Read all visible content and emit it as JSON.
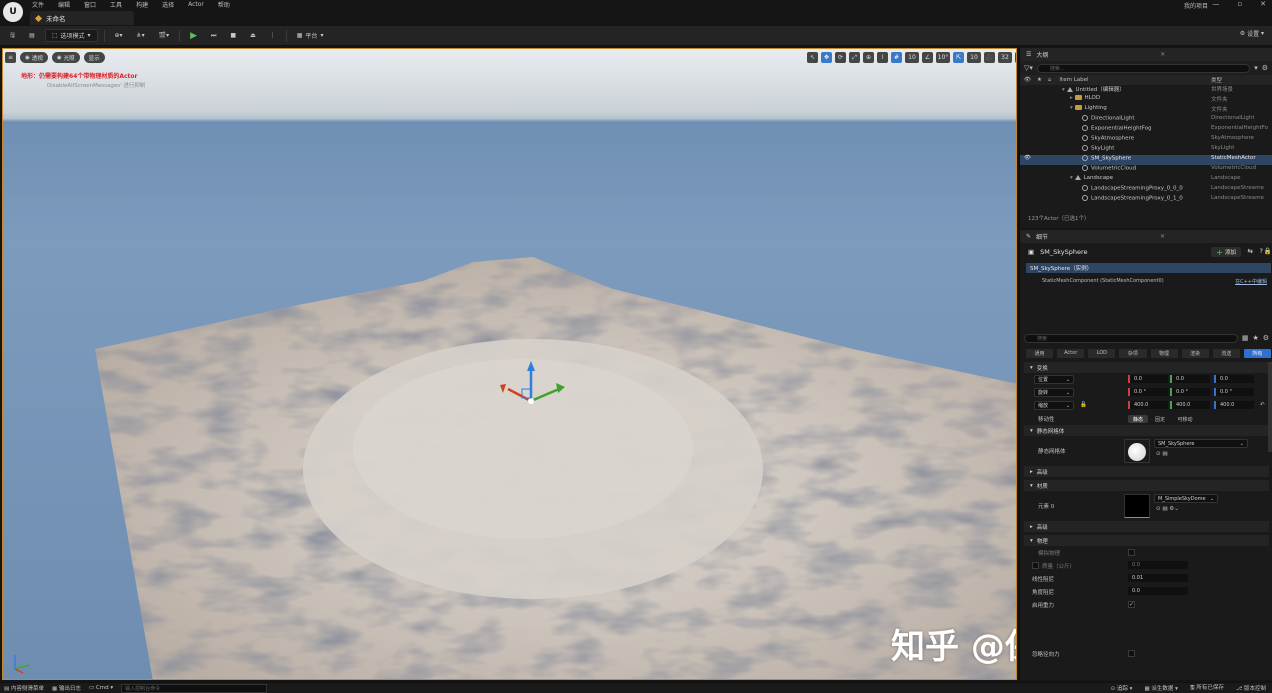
{
  "menubar": {
    "logo": "U",
    "items": [
      "文件",
      "编辑",
      "窗口",
      "工具",
      "构建",
      "选择",
      "Actor",
      "帮助"
    ],
    "tab_title": "未命名",
    "project_name": "我的项目",
    "window_controls": [
      "—",
      "▫",
      "✕"
    ]
  },
  "toolbar": {
    "mode_label": "选项模式",
    "platform_label": "平台",
    "settings_label": "设置"
  },
  "viewport": {
    "pills": [
      "透视",
      "光照",
      "显示"
    ],
    "right_numbers": [
      "10",
      "10°",
      "10",
      "32"
    ],
    "message_red": "地形：仍需要构建64个带物理材质的Actor",
    "message_gray": "DisableAllScreenMessages' 进行抑制",
    "watermark": "知乎 @保护我小月月"
  },
  "outliner": {
    "tab_title": "大纲",
    "search_placeholder": "搜索...",
    "col_label": "Item Label",
    "col_type": "类型",
    "rows": [
      {
        "label": "Untitled（编辑器）",
        "type": "世界场景",
        "indent": 0
      },
      {
        "label": "HLOD",
        "type": "文件夹",
        "indent": 1
      },
      {
        "label": "Lighting",
        "type": "文件夹",
        "indent": 1
      },
      {
        "label": "DirectionalLight",
        "type": "DirectionalLight",
        "indent": 2
      },
      {
        "label": "ExponentialHeightFog",
        "type": "ExponentialHeightFo",
        "indent": 2
      },
      {
        "label": "SkyAtmosphere",
        "type": "SkyAtmosphere",
        "indent": 2
      },
      {
        "label": "SkyLight",
        "type": "SkyLight",
        "indent": 2
      },
      {
        "label": "SM_SkySphere",
        "type": "StaticMeshActor",
        "indent": 2
      },
      {
        "label": "VolumetricCloud",
        "type": "VolumetricCloud",
        "indent": 2
      },
      {
        "label": "Landscape",
        "type": "Landscape",
        "indent": 1
      },
      {
        "label": "LandscapeStreamingProxy_0_0_0",
        "type": "LandscapeStreame",
        "indent": 2
      },
      {
        "label": "LandscapeStreamingProxy_0_1_0",
        "type": "LandscapeStreame",
        "indent": 2
      }
    ],
    "count_text": "123个Actor（已选1个）"
  },
  "details": {
    "tab_title": "细节",
    "actor_name": "SM_SkySphere",
    "add_label": "添加",
    "component_root": "SM_SkySphere（实例）",
    "component_child": "StaticMeshComponent (StaticMeshComponent0)",
    "component_cpp": "在C++中编辑",
    "search_placeholder": "搜索",
    "category_tabs": [
      "通用",
      "Actor",
      "LOD",
      "杂项",
      "物理",
      "渲染",
      "流送",
      "所有"
    ],
    "transform_section": "变换",
    "location_label": "位置",
    "rotation_label": "旋转",
    "scale_label": "缩放",
    "location": [
      "0.0",
      "0.0",
      "0.0"
    ],
    "rotation": [
      "0.0 °",
      "0.0 °",
      "0.0 °"
    ],
    "scale": [
      "400.0",
      "400.0",
      "400.0"
    ],
    "mobility_label": "移动性",
    "mobility_options": [
      "静态",
      "固定",
      "可移动"
    ],
    "static_mesh_section": "静态网格体",
    "static_mesh_label": "静态网格体",
    "static_mesh_value": "SM_SkySphere",
    "advanced_section": "高级",
    "materials_section": "材质",
    "element_label": "元素 0",
    "material_value": "M_SimpleSkyDome",
    "advanced_section2": "高级",
    "physics_section": "物理",
    "simulate_physics": "模拟物理",
    "mass_label": "质量（公斤）",
    "mass_value": "0.0",
    "linear_damping": "线性阻尼",
    "linear_damping_value": "0.01",
    "angular_damping": "角度阻尼",
    "angular_damping_value": "0.0",
    "enable_gravity": "启用重力",
    "ignore_radial": "忽略径向力"
  },
  "statusbar": {
    "content_drawer": "内容侧滑菜单",
    "output_log": "输出日志",
    "cmd": "Cmd",
    "cmd_placeholder": "输入控制台命令",
    "right_items": [
      "追踪",
      "派生数据",
      "所有已保存",
      "版本控制"
    ]
  }
}
